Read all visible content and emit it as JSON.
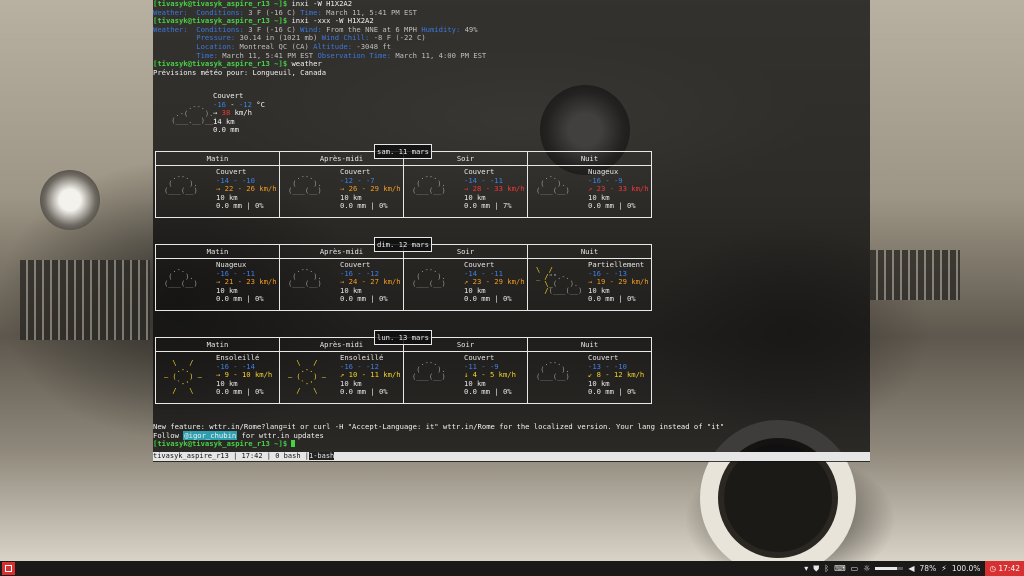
{
  "terminal": {
    "prompt": "[tivasyk@tivasyk_aspire_r13 ~]$",
    "cmd1": " inxi -W H1X2A2",
    "r1": {
      "weather_key": "Weather:",
      "conditions_key": "Conditions:",
      "conditions_val": " 3 F (-16 C) ",
      "time_key": "Time:",
      "time_val": " March 11, 5:41 PM EST"
    },
    "cmd2": " inxi -xxx -W H1X2A2",
    "r2": {
      "weather_key": "Weather:",
      "conditions_key": "Conditions:",
      "conditions_val": " 3 F (-16 C) ",
      "wind_key": "Wind:",
      "wind_val": " From the NNE at 6 MPH ",
      "humidity_key": "Humidity:",
      "humidity_val": " 49%",
      "pressure_key": "Pressure:",
      "pressure_val": " 30.14 in (1021 mb) ",
      "windchill_key": "Wind Chill:",
      "windchill_val": " -8 F (-22 C)",
      "location_key": "Location:",
      "location_val": " Montreal QC (CA) ",
      "altitude_key": "Altitude:",
      "altitude_val": " -3048 ft",
      "time_key": "Time:",
      "time_val": " March 11, 5:41 PM EST ",
      "obs_key": "Observation Time:",
      "obs_val": " March 11, 4:00 PM EST"
    },
    "cmd3": " weather",
    "forecast_title": "Prévisions météo pour: Longueuil, Canada",
    "current": {
      "condition": "Couvert",
      "temp_a": "-16",
      "temp_b": "-12",
      "temp_unit": " °C",
      "wind_arrow": "→ ",
      "wind": "38",
      "wind_unit": " km/h",
      "visibility": "14 km",
      "precip": "0.0 mm"
    },
    "days": [
      {
        "label": "sam. 11 mars",
        "periods": [
          {
            "name": "Matin",
            "condition": "Couvert",
            "temp": "-14 - -10",
            "wind": "→ 22 - 26 km/h",
            "visibility": "10 km",
            "precip": "0.0 mm | 0%"
          },
          {
            "name": "Après-midi",
            "condition": "Couvert",
            "temp": "-12 - -7",
            "wind": "→ 26 - 29 km/h",
            "visibility": "10 km",
            "precip": "0.0 mm | 0%"
          },
          {
            "name": "Soir",
            "condition": "Couvert",
            "temp": "-14 - -11",
            "wind": "→ 28 - 33 km/h",
            "visibility": "10 km",
            "precip": "0.0 mm | 7%"
          },
          {
            "name": "Nuit",
            "condition": "Nuageux",
            "temp": "-16 - -9",
            "wind": "↗ 23 - 33 km/h",
            "visibility": "10 km",
            "precip": "0.0 mm | 0%"
          }
        ]
      },
      {
        "label": "dim. 12 mars",
        "periods": [
          {
            "name": "Matin",
            "condition": "Nuageux",
            "temp": "-16 - -11",
            "wind": "→ 21 - 23 km/h",
            "visibility": "10 km",
            "precip": "0.0 mm | 0%"
          },
          {
            "name": "Après-midi",
            "condition": "Couvert",
            "temp": "-16 - -12",
            "wind": "→ 24 - 27 km/h",
            "visibility": "10 km",
            "precip": "0.0 mm | 0%"
          },
          {
            "name": "Soir",
            "condition": "Couvert",
            "temp": "-14 - -11",
            "wind": "↗ 23 - 29 km/h",
            "visibility": "10 km",
            "precip": "0.0 mm | 0%"
          },
          {
            "name": "Nuit",
            "condition": "Partiellement",
            "temp": "-16 - -13",
            "wind": "→ 19 - 29 km/h",
            "visibility": "10 km",
            "precip": "0.0 mm | 0%"
          }
        ]
      },
      {
        "label": "lun. 13 mars",
        "periods": [
          {
            "name": "Matin",
            "condition": "Ensoleillé",
            "temp": "-16 - -14",
            "wind": "→ 9 - 10 km/h",
            "visibility": "10 km",
            "precip": "0.0 mm | 0%"
          },
          {
            "name": "Après-midi",
            "condition": "Ensoleillé",
            "temp": "-16 - -12",
            "wind": "↗ 10 - 11 km/h",
            "visibility": "10 km",
            "precip": "0.0 mm | 0%"
          },
          {
            "name": "Soir",
            "condition": "Couvert",
            "temp": "-11 - -9",
            "wind": "↓ 4 - 5 km/h",
            "visibility": "10 km",
            "precip": "0.0 mm | 0%"
          },
          {
            "name": "Nuit",
            "condition": "Couvert",
            "temp": "-13 - -10",
            "wind": "↙ 8 - 12 km/h",
            "visibility": "10 km",
            "precip": "0.0 mm | 0%"
          }
        ]
      }
    ],
    "footer1": "New feature: wttr.in/Rome?lang=it or curl -H \"Accept-Language: it\" wttr.in/Rome for the localized version. Your lang instead of \"it\"",
    "footer2_pre": "Follow ",
    "footer2_handle": "@igor_chubin",
    "footer2_post": " for wttr.in updates"
  },
  "tmux": {
    "session": "tivasyk_aspire_r13",
    "time": "17:42",
    "window": "0 bash",
    "current": "1-bash"
  },
  "panel": {
    "volume_pct": 78,
    "volume_label": "78%",
    "battery_label": "100.0%",
    "clock": "17:42",
    "colors": {
      "accent": "#d63030",
      "panel_bg": "#1b1a18"
    }
  }
}
